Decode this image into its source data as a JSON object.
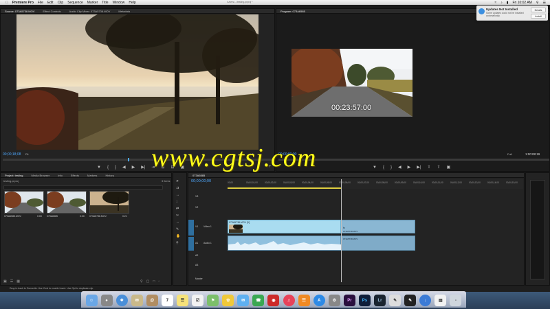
{
  "menubar": {
    "items": [
      "Premiere Pro",
      "File",
      "Edit",
      "Clip",
      "Sequence",
      "Marker",
      "Title",
      "Window",
      "Help"
    ],
    "doc_path": "/Users/.../testing.prproj *",
    "clock": "Fri 10:02 AM"
  },
  "source": {
    "tabs": [
      "Source: 073A5738.MOV",
      "Effect Controls",
      "Audio Clip Mixer: 073A5738.MOV",
      "Metadata"
    ],
    "timecode": "00;00;18;08",
    "fit": "Fit",
    "page": "1/2"
  },
  "program": {
    "tab": "Program: 073A6585",
    "overlay_timecode": "00:23:57:00",
    "timecode": "00:00:00:00",
    "fit": "Full",
    "duration": "1:00:08:19"
  },
  "watermark": "www.cgtsj.com",
  "project": {
    "tabs": [
      "Project: testing",
      "Media Browser",
      "Info",
      "Effects",
      "Markers",
      "History"
    ],
    "path": "testing.prproj",
    "item_count": "3 Items",
    "clips": [
      {
        "name": "073A6585.MOV",
        "duration": "0:00"
      },
      {
        "name": "073A6585",
        "duration": "0:00"
      },
      {
        "name": "073A5738.MOV",
        "duration": "0:21"
      }
    ]
  },
  "timeline": {
    "tab": "073A6585",
    "timecode": "00;00;00;00",
    "ruler": [
      "00;00",
      "00;00;01;00",
      "00;00;02;00",
      "00;00;03;00",
      "00;00;04;00",
      "00;00;05;00",
      "00;00;06;00",
      "00;00;07;00",
      "00;00;08;00",
      "00;00;09;00",
      "00;00;10;00",
      "00;00;11;00",
      "00;00;12;00",
      "00;00;13;00",
      "00;00;14;00",
      "00;00;15;00"
    ],
    "tracks": [
      "V3",
      "V2",
      "V1",
      "A1",
      "A2",
      "A3"
    ],
    "video_label": "Video 1",
    "audio_label": "Audio 1",
    "master": "Master",
    "clip_v1": "073A5738.MOV [V]",
    "clip_v2": "073A5738.MOV",
    "clip_a1": "073A5738.MOV",
    "fx": "fx"
  },
  "status": "Drop in track to Overwrite. Use Cmd to enable Insert. Use Opt to duplicate clip.",
  "notification": {
    "title": "Updates Not Installed",
    "body": "Some updates could not be installed automatically.",
    "details": "Details",
    "install": "Install"
  },
  "dock": [
    "Finder",
    "Launchpad",
    "Safari",
    "Mail",
    "Contacts",
    "Calendar",
    "Notes",
    "Reminders",
    "Maps",
    "Photos",
    "Messages",
    "FaceTime",
    "Photo Booth",
    "iTunes",
    "iBooks",
    "App Store",
    "System Preferences",
    "Pr",
    "Ps",
    "Lr",
    "Preview",
    "Clapper",
    "Downloads",
    "Documents",
    "Trash"
  ]
}
